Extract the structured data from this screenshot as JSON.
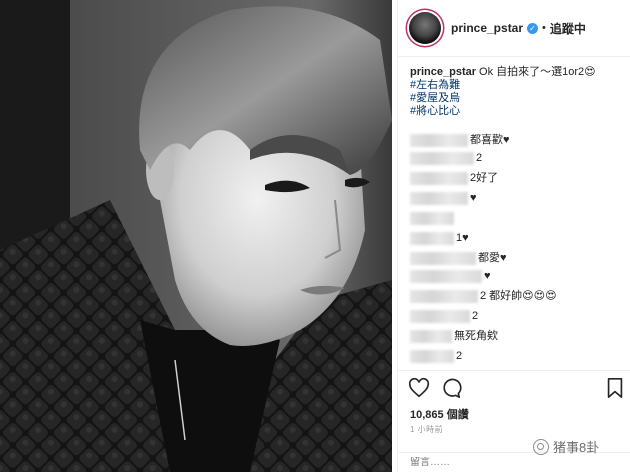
{
  "post": {
    "username": "prince_pstar",
    "follow_label": "追蹤中",
    "caption_text": "Ok 自拍來了～選1or2😍",
    "hashtags": [
      "#左右為難",
      "#愛屋及烏",
      "#將心比心"
    ]
  },
  "comments": [
    {
      "text": "都喜歡♥"
    },
    {
      "text": "2"
    },
    {
      "text": "2好了"
    },
    {
      "text": "♥"
    },
    {
      "text": "1♥"
    },
    {
      "text": "都愛♥"
    },
    {
      "text": "♥"
    },
    {
      "text": "2 都好帥😍😍😍"
    },
    {
      "text": "2"
    },
    {
      "text": "無死角欸"
    },
    {
      "text": "2"
    }
  ],
  "engagement": {
    "likes_text": "10,865 個讚",
    "time_text": "1 小時前"
  },
  "add_comment": {
    "placeholder": "留言……"
  },
  "watermark": {
    "text": "猪事8卦"
  },
  "icons": [
    "verified-badge-icon",
    "heart-icon",
    "comment-icon",
    "bookmark-icon",
    "wechat-icon"
  ],
  "colors": {
    "link": "#003569",
    "verified": "#3897f0",
    "divider": "#efefef"
  }
}
